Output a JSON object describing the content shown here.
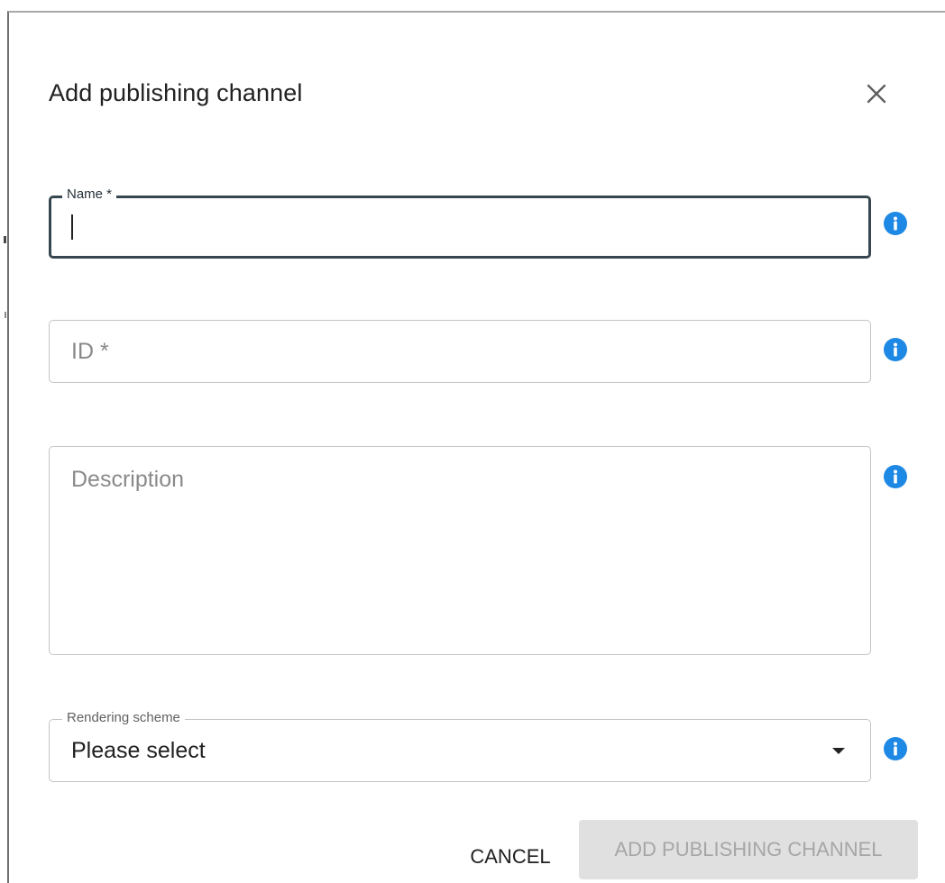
{
  "dialog": {
    "title": "Add publishing channel",
    "close_icon": "close-icon"
  },
  "fields": {
    "name": {
      "label": "Name *",
      "value": "",
      "focused": true,
      "info_icon": "info-icon"
    },
    "id": {
      "placeholder": "ID *",
      "value": "",
      "info_icon": "info-icon"
    },
    "description": {
      "placeholder": "Description",
      "value": "",
      "info_icon": "info-icon"
    },
    "rendering_scheme": {
      "label": "Rendering scheme",
      "selected": "Please select",
      "dropdown_icon": "caret-down-icon",
      "info_icon": "info-icon"
    }
  },
  "actions": {
    "cancel_label": "CANCEL",
    "add_label": "ADD PUBLISHING CHANNEL",
    "add_disabled": true
  },
  "colors": {
    "info_blue": "#1e88e5",
    "focus_border": "#37474f",
    "disabled_bg": "#e0e0e0",
    "disabled_text": "#a6a6a6"
  }
}
